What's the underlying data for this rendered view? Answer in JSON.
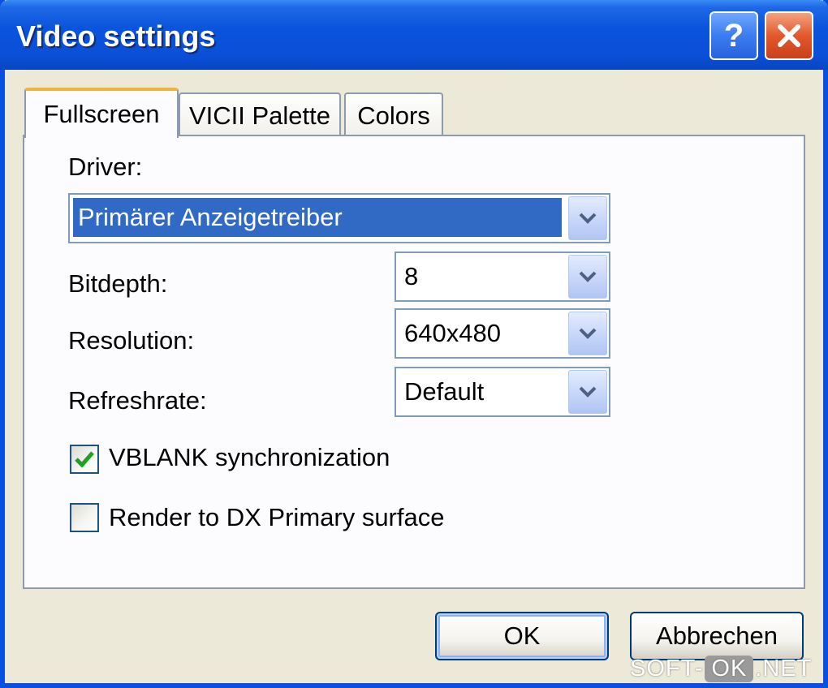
{
  "window": {
    "title": "Video settings",
    "help_glyph": "?"
  },
  "tabs": [
    {
      "label": "Fullscreen",
      "active": true
    },
    {
      "label": "VICII Palette",
      "active": false
    },
    {
      "label": "Colors",
      "active": false
    }
  ],
  "fullscreen": {
    "driver_label": "Driver:",
    "driver_value": "Primärer Anzeigetreiber",
    "bitdepth_label": "Bitdepth:",
    "bitdepth_value": "8",
    "resolution_label": "Resolution:",
    "resolution_value": "640x480",
    "refreshrate_label": "Refreshrate:",
    "refreshrate_value": "Default",
    "vblank_label": "VBLANK synchronization",
    "vblank_checked": true,
    "render_dx_label": "Render to DX Primary surface",
    "render_dx_checked": false
  },
  "buttons": {
    "ok_label": "OK",
    "cancel_label": "Abbrechen"
  },
  "watermark": {
    "prefix": "SOFT-",
    "box": "OK",
    "suffix": ".NET"
  },
  "icons": {
    "help": "help-icon",
    "close": "close-icon",
    "dropdown": "chevron-down-icon",
    "check": "checkmark-icon"
  },
  "colors": {
    "titlebar": "#0a54dc",
    "selection": "#316ac5",
    "tab_highlight": "#f2b33a",
    "check_green": "#21a121",
    "close_red": "#e2592d"
  }
}
